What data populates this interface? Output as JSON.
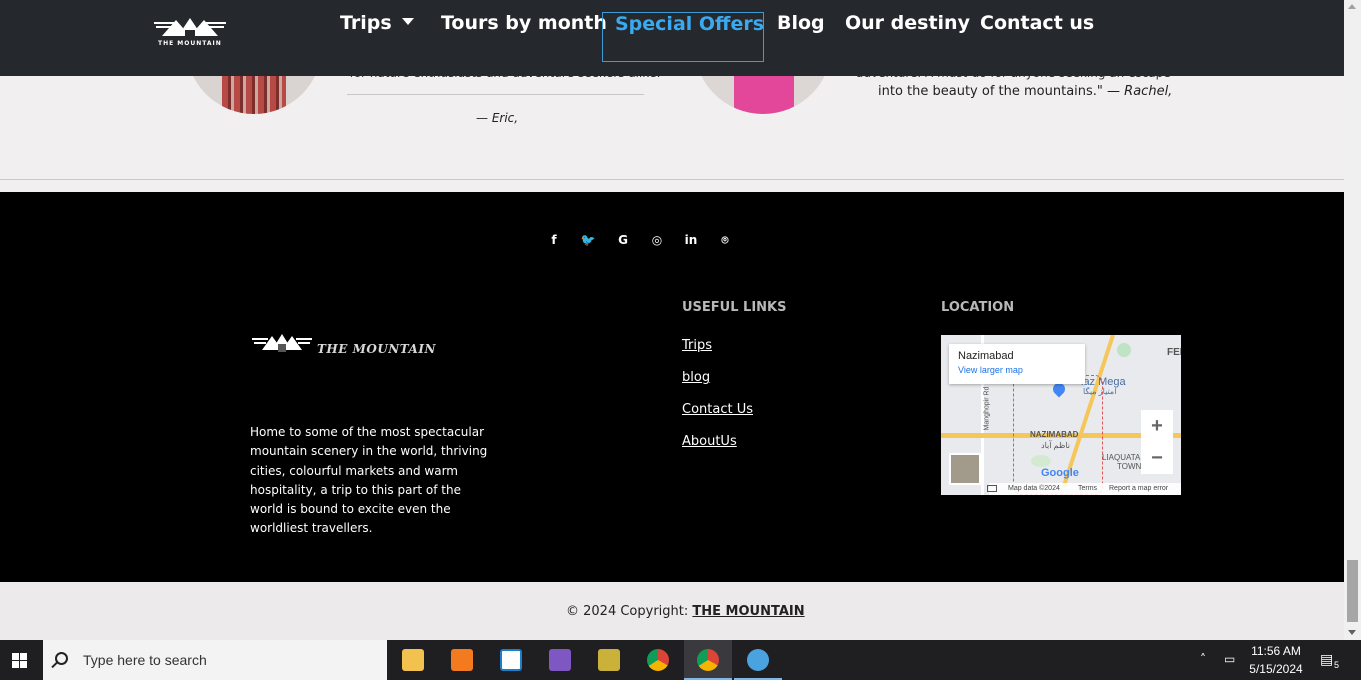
{
  "nav": {
    "logo_text": "THE MOUNTAIN",
    "items": [
      {
        "label": "Trips"
      },
      {
        "label": "Tours by month"
      },
      {
        "label": "Special Offers"
      },
      {
        "label": "Blog"
      },
      {
        "label": "Our destiny"
      },
      {
        "label": "Contact us"
      }
    ]
  },
  "testimonials": {
    "eric_fragment": "for nature enthusiasts and adventure seekers alike.\"",
    "eric_author": "— Eric,",
    "rachel_fragment": "adventure. A must-do for anyone seeking an escape",
    "rachel_line": "into the beauty of the mountains.\"",
    "rachel_author": "— Rachel,"
  },
  "footer": {
    "social": [
      {
        "icon": "facebook-icon",
        "glyph": "f"
      },
      {
        "icon": "twitter-icon",
        "glyph": "🐦"
      },
      {
        "icon": "google-icon",
        "glyph": "G"
      },
      {
        "icon": "instagram-icon",
        "glyph": "◎"
      },
      {
        "icon": "linkedin-icon",
        "glyph": "in"
      },
      {
        "icon": "github-icon",
        "glyph": "⌾"
      }
    ],
    "logo_text": "THE MOUNTAIN",
    "about": "Home to some of the most spectacular mountain scenery in the world, thriving cities, colourful markets and warm hospitality, a trip to this part of the world is bound to excite even the worldliest travellers.",
    "useful_links_title": "USEFUL LINKS",
    "links": [
      "Trips",
      "blog",
      "Contact Us",
      "AboutUs"
    ],
    "location_title": "LOCATION",
    "map": {
      "place": "Nazimabad",
      "view_larger": "View larger map",
      "label_fed": "FED",
      "label_imtiaz": "iaz Mega",
      "label_imtiaz_urdu": "امتیاز میگا",
      "label_nazimabad": "NAZIMABAD",
      "label_nazimabad_urdu": "ناظم آباد",
      "label_liaquatabad": "LIAQUATA",
      "label_town": "TOWN",
      "label_manghopir": "Manghopir Rd",
      "google": "Google",
      "map_data": "Map data ©2024",
      "terms": "Terms",
      "report": "Report a map error",
      "zoom_in": "+",
      "zoom_out": "−"
    }
  },
  "copyright": {
    "prefix": "© 2024 Copyright:",
    "brand": "THE MOUNTAIN"
  },
  "taskbar": {
    "search_placeholder": "Type here to search",
    "time": "11:56 AM",
    "date": "5/15/2024",
    "notifications": "5",
    "apps": [
      {
        "name": "file-explorer",
        "color": "#f2c14e"
      },
      {
        "name": "xampp",
        "color": "#f47a20"
      },
      {
        "name": "vscode-insiders",
        "color": "#ffffff"
      },
      {
        "name": "visual-studio",
        "color": "#7e57c2"
      },
      {
        "name": "tool-app",
        "color": "#c9b13a"
      },
      {
        "name": "chrome",
        "color": "#e34234"
      },
      {
        "name": "chrome-profile",
        "color": "#db4437"
      },
      {
        "name": "app-umbrella",
        "color": "#4aa3df"
      }
    ]
  }
}
